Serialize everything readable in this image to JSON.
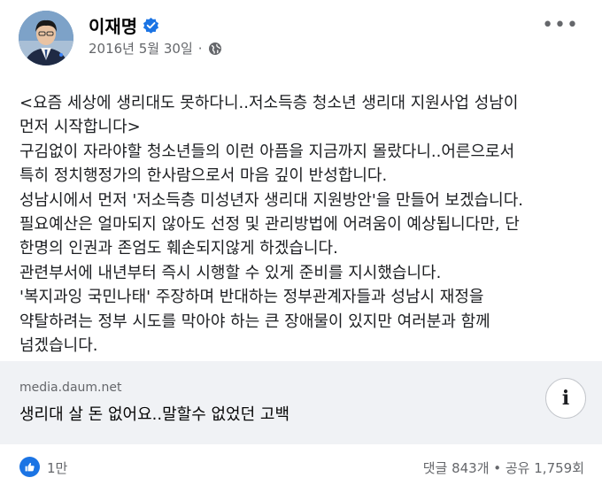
{
  "post": {
    "author": "이재명",
    "date": "2016년 5월 30일",
    "separator": "·",
    "lines": [
      "<요즘 세상에 생리대도 못하다니..저소득층 청소년 생리대 지원사업 성남이",
      "먼저 시작합니다>",
      "구김없이 자라야할 청소년들의 이런 아픔을 지금까지 몰랐다니..어른으로서",
      "특히 정치행정가의 한사람으로서 마음 깊이 반성합니다.",
      "성남시에서 먼저 '저소득층 미성년자 생리대 지원방안'을 만들어 보겠습니다.",
      "필요예산은 얼마되지 않아도 선정 및 관리방법에 어려움이 예상됩니다만, 단",
      "한명의 인권과 존엄도 훼손되지않게 하겠습니다.",
      "관련부서에 내년부터 즉시 시행할 수 있게 준비를 지시했습니다.",
      "'복지과잉 국민나태' 주장하며 반대하는 정부관계자들과 성남시 재정을",
      "약탈하려는 정부 시도를 막아야 하는 큰 장애물이 있지만 여러분과 함께",
      "넘겠습니다."
    ]
  },
  "link": {
    "domain": "media.daum.net",
    "title": "생리대 살 돈 없어요..말할수 없었던 고백",
    "info_glyph": "i"
  },
  "footer": {
    "likes": "1만",
    "stats": "댓글 843개 • 공유 1,759회"
  },
  "icons": {
    "verified": "verified-badge-icon",
    "audience": "globe-icon",
    "menu": "more-options-icon",
    "reaction": "like-thumb-icon",
    "info": "info-icon"
  },
  "colors": {
    "accent": "#1b74e4",
    "muted_text": "#65676b",
    "link_background": "#f0f2f5"
  }
}
